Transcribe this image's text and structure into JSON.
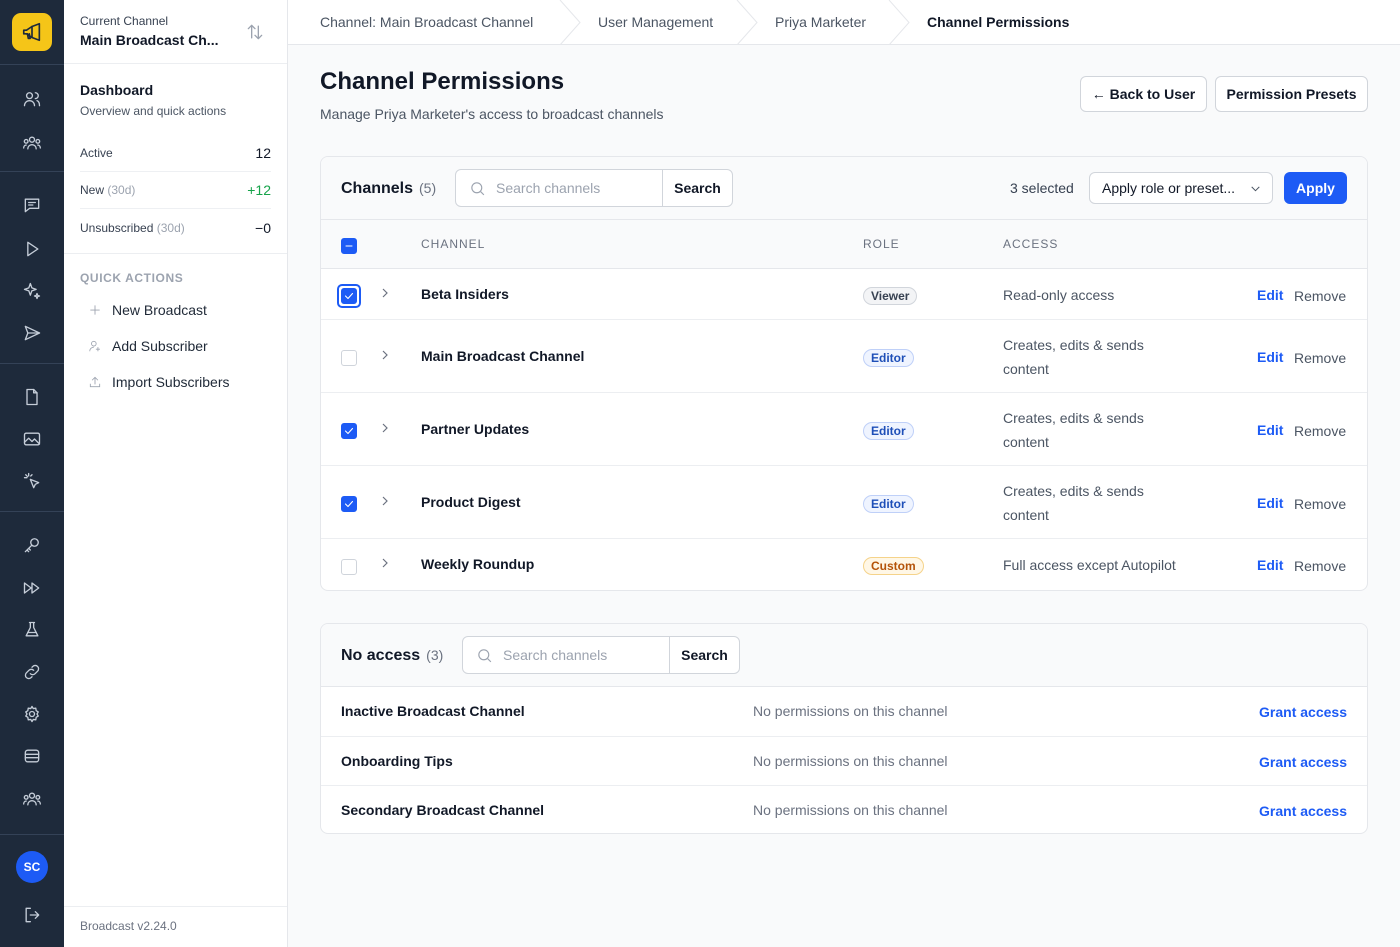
{
  "sidebar": {
    "current_channel_label": "Current Channel",
    "current_channel_name": "Main Broadcast Ch...",
    "dashboard_title": "Dashboard",
    "dashboard_sub": "Overview and quick actions",
    "stats": [
      {
        "label": "Active",
        "suffix": "",
        "value": "12"
      },
      {
        "label": "New",
        "suffix": "(30d)",
        "value": "+12"
      },
      {
        "label": "Unsubscribed",
        "suffix": "(30d)",
        "value": "−0"
      }
    ],
    "quick_actions_title": "QUICK ACTIONS",
    "quick_actions": [
      {
        "label": "New Broadcast",
        "icon": "plus-icon"
      },
      {
        "label": "Add Subscriber",
        "icon": "add-user-icon"
      },
      {
        "label": "Import Subscribers",
        "icon": "upload-icon"
      }
    ],
    "version": "Broadcast v2.24.0"
  },
  "rail": {
    "avatar_initials": "SC",
    "accent": "#f5c518",
    "icons": [
      "subscribers-icon",
      "segments-icon",
      "messages-icon",
      "play-icon",
      "sparkles-icon",
      "send-icon",
      "document-icon",
      "image-icon",
      "click-icon",
      "key-icon",
      "fast-forward-icon",
      "flask-icon",
      "link-icon",
      "gear-icon",
      "database-icon",
      "team-icon",
      "logout-icon"
    ]
  },
  "breadcrumb": [
    "Channel: Main Broadcast Channel",
    "User Management",
    "Priya Marketer",
    "Channel Permissions"
  ],
  "header": {
    "title": "Channel Permissions",
    "subtitle": "Manage Priya Marketer's access to broadcast channels",
    "back_button": "← Back to User",
    "presets_button": "Permission Presets"
  },
  "channels": {
    "title": "Channels",
    "count": "(5)",
    "search_placeholder": "Search channels",
    "search_button": "Search",
    "selected_text": "3 selected",
    "bulk_select_value": "Apply role or preset...",
    "apply_button": "Apply",
    "columns": [
      "CHANNEL",
      "ROLE",
      "ACCESS"
    ],
    "rows": [
      {
        "name": "Beta Insiders",
        "role": "Viewer",
        "role_kind": "viewer",
        "access": "Read-only access",
        "checked": true,
        "edit": "Edit",
        "remove": "Remove"
      },
      {
        "name": "Main Broadcast Channel",
        "role": "Editor",
        "role_kind": "editor",
        "access": "Creates, edits & sends content",
        "checked": false,
        "edit": "Edit",
        "remove": "Remove"
      },
      {
        "name": "Partner Updates",
        "role": "Editor",
        "role_kind": "editor",
        "access": "Creates, edits & sends content",
        "checked": true,
        "edit": "Edit",
        "remove": "Remove"
      },
      {
        "name": "Product Digest",
        "role": "Editor",
        "role_kind": "editor",
        "access": "Creates, edits & sends content",
        "checked": true,
        "edit": "Edit",
        "remove": "Remove"
      },
      {
        "name": "Weekly Roundup",
        "role": "Custom",
        "role_kind": "custom",
        "access": "Full access except Autopilot",
        "checked": false,
        "edit": "Edit",
        "remove": "Remove"
      }
    ]
  },
  "no_access": {
    "title": "No access",
    "count": "(3)",
    "search_placeholder": "Search channels",
    "search_button": "Search",
    "rows": [
      {
        "name": "Inactive Broadcast Channel",
        "message": "No permissions on this channel",
        "action": "Grant access"
      },
      {
        "name": "Onboarding Tips",
        "message": "No permissions on this channel",
        "action": "Grant access"
      },
      {
        "name": "Secondary Broadcast Channel",
        "message": "No permissions on this channel",
        "action": "Grant access"
      }
    ]
  }
}
